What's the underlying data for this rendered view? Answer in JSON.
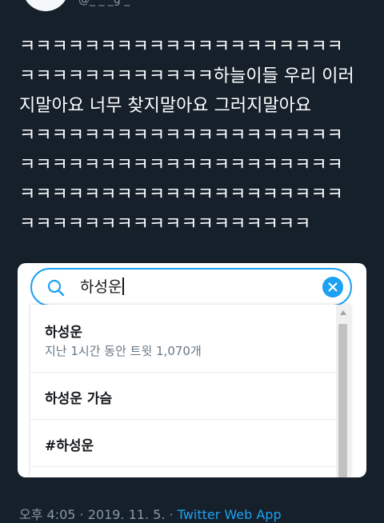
{
  "tweet": {
    "handle": "@_ _ _g _ ·",
    "text": "ㅋㅋㅋㅋㅋㅋㅋㅋㅋㅋㅋㅋㅋㅋㅋㅋㅋㅋㅋㅋ\nㅋㅋㅋㅋㅋㅋㅋㅋㅋㅋㅋㅋ하늘이들 우리 이러\n지말아요 너무 찾지말아요 그러지말아요\nㅋㅋㅋㅋㅋㅋㅋㅋㅋㅋㅋㅋㅋㅋㅋㅋㅋㅋㅋㅋ\nㅋㅋㅋㅋㅋㅋㅋㅋㅋㅋㅋㅋㅋㅋㅋㅋㅋㅋㅋㅋ\nㅋㅋㅋㅋㅋㅋㅋㅋㅋㅋㅋㅋㅋㅋㅋㅋㅋㅋㅋㅋ\nㅋㅋㅋㅋㅋㅋㅋㅋㅋㅋㅋㅋㅋㅋㅋㅋㅋㅋ"
  },
  "search": {
    "value": "하성운"
  },
  "suggestions": [
    {
      "title": "하성운",
      "subtitle": "지난 1시간 동안 트윗 1,070개"
    },
    {
      "title": "하성운 가슴"
    },
    {
      "title": "#하성운"
    }
  ],
  "footer": {
    "timestamp": "오후 4:05 · 2019. 11. 5. · ",
    "source": "Twitter Web App"
  },
  "colors": {
    "background": "#15202b",
    "accent": "#1da1f2",
    "muted": "#8899a6"
  }
}
